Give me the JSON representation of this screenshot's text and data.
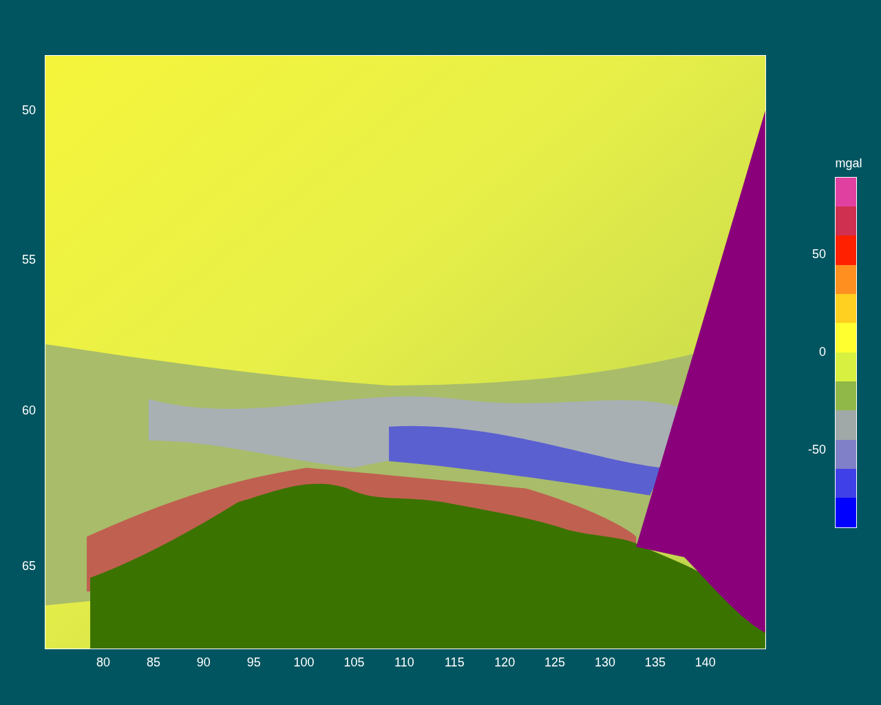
{
  "map": {
    "x_ticks": [
      "80",
      "85",
      "90",
      "95",
      "100",
      "105",
      "110",
      "115",
      "120",
      "125",
      "130",
      "135",
      "140"
    ],
    "y_ticks": [
      "50",
      "55",
      "60",
      "65"
    ]
  },
  "colorbar": {
    "unit": "mgal",
    "ticks": [
      "50",
      "0",
      "-50"
    ]
  }
}
